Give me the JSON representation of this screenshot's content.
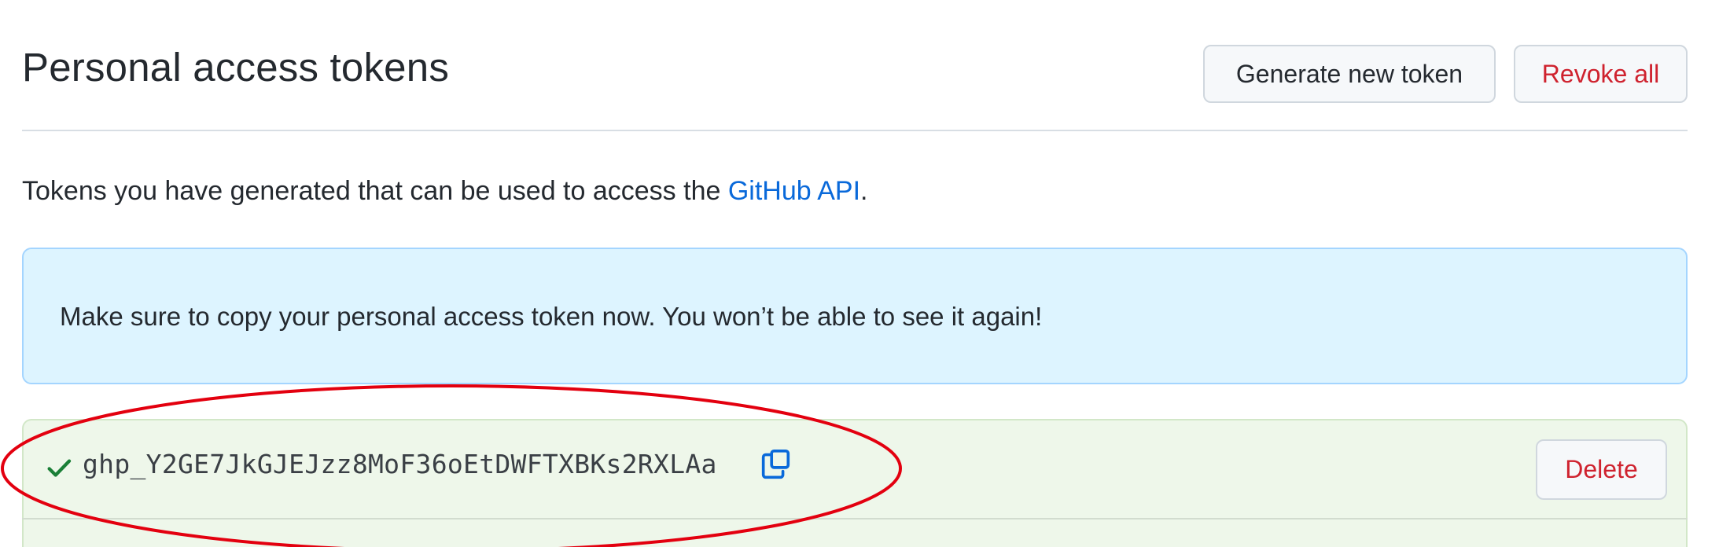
{
  "header": {
    "title": "Personal access tokens",
    "generate_label": "Generate new token",
    "revoke_label": "Revoke all"
  },
  "intro": {
    "text": "Tokens you have generated that can be used to access the ",
    "link_text": "GitHub API",
    "suffix": "."
  },
  "flash": {
    "message": "Make sure to copy your personal access token now. You won’t be able to see it again!"
  },
  "token": {
    "value": "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",
    "status_icon": "check-icon",
    "copy_icon": "copy-icon",
    "delete_label": "Delete"
  },
  "colors": {
    "danger": "#cf222e",
    "link": "#0969da",
    "success": "#1a7f37",
    "flash_bg": "#ddf4ff",
    "token_bg": "#eef7ea",
    "annotation": "#e3000f"
  }
}
